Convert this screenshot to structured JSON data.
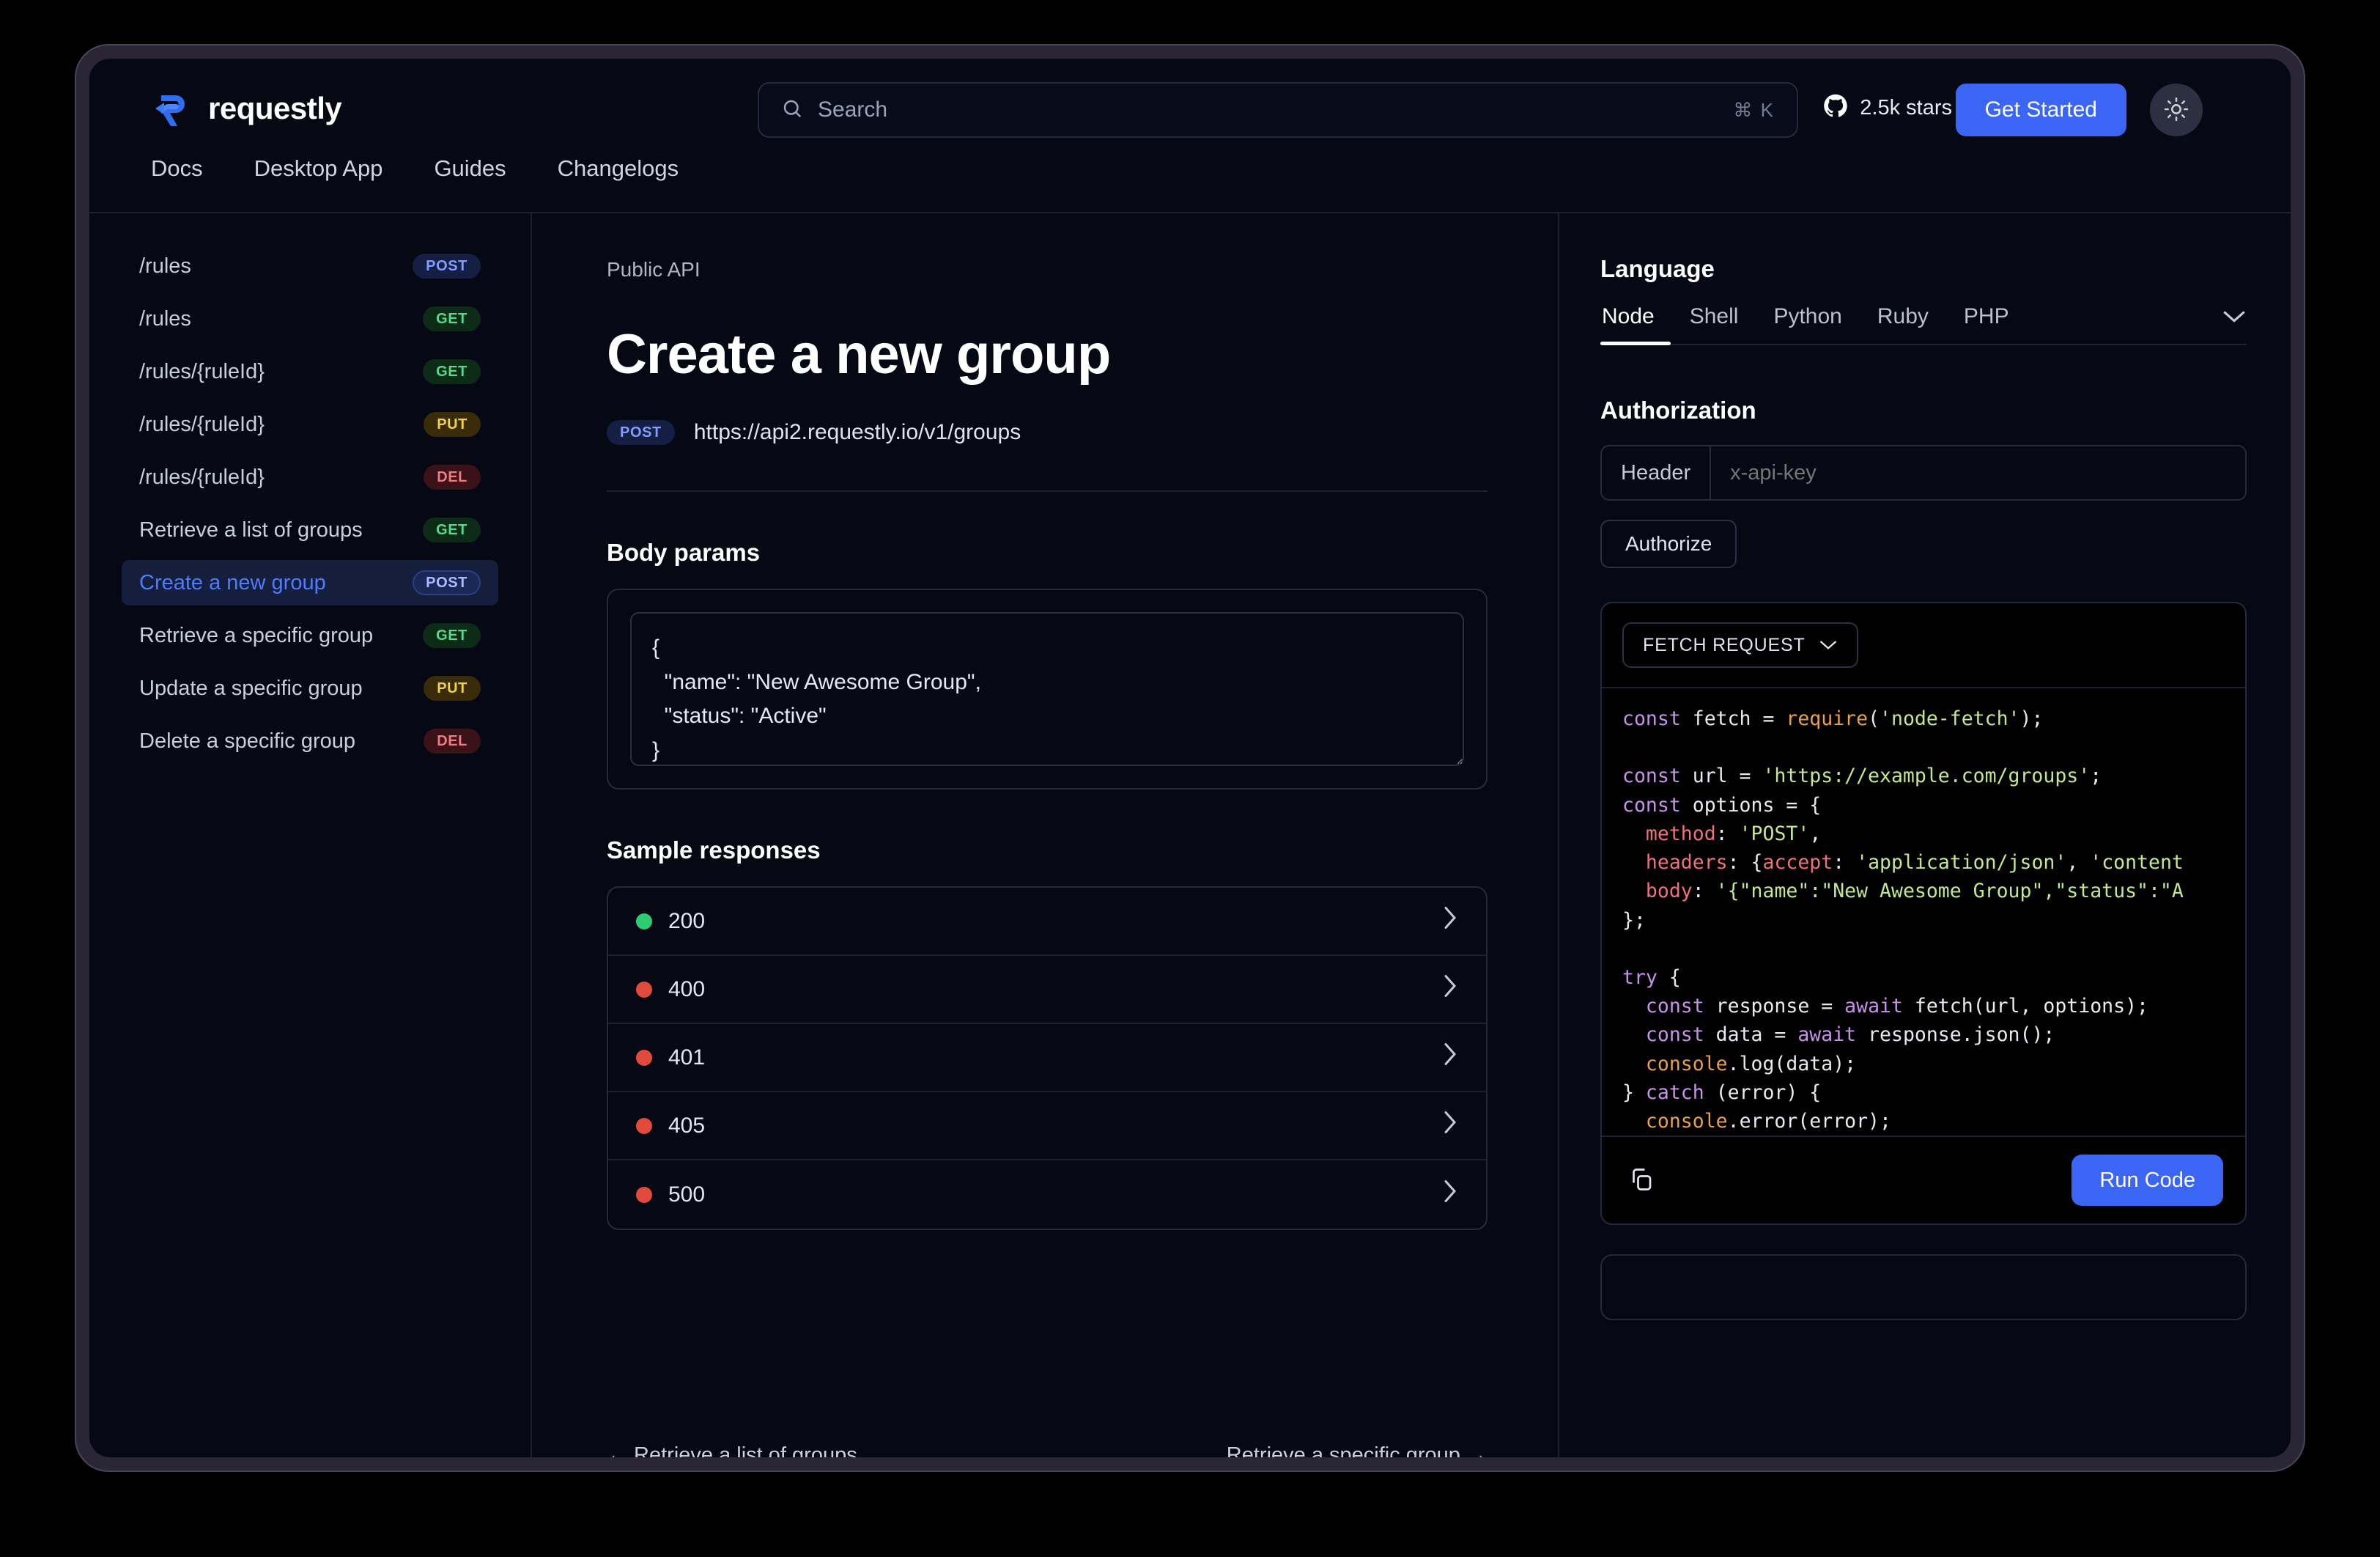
{
  "brand": {
    "name": "requestly",
    "logo_icon": "requestly-r-logo"
  },
  "search": {
    "placeholder": "Search",
    "shortcut": "⌘ K",
    "icon": "search-icon"
  },
  "header": {
    "github_icon": "github-icon",
    "stars_label": "2.5k stars",
    "get_started_label": "Get Started",
    "theme_icon": "sun-icon"
  },
  "nav": {
    "tabs": [
      "Docs",
      "Desktop App",
      "Guides",
      "Changelogs"
    ]
  },
  "sidebar": {
    "items": [
      {
        "label": "/rules",
        "method": "POST",
        "active": false
      },
      {
        "label": "/rules",
        "method": "GET",
        "active": false
      },
      {
        "label": "/rules/{ruleId}",
        "method": "GET",
        "active": false
      },
      {
        "label": "/rules/{ruleId}",
        "method": "PUT",
        "active": false
      },
      {
        "label": "/rules/{ruleId}",
        "method": "DEL",
        "active": false
      },
      {
        "label": "Retrieve a list of groups",
        "method": "GET",
        "active": false
      },
      {
        "label": "Create a new group",
        "method": "POST",
        "active": true
      },
      {
        "label": "Retrieve a specific group",
        "method": "GET",
        "active": false
      },
      {
        "label": "Update a specific group",
        "method": "PUT",
        "active": false
      },
      {
        "label": "Delete a specific group",
        "method": "DEL",
        "active": false
      }
    ]
  },
  "main": {
    "breadcrumb": "Public API",
    "title": "Create a new group",
    "endpoint_method": "POST",
    "endpoint_url": "https://api2.requestly.io/v1/groups",
    "body_params_heading": "Body params",
    "body_params_value": "{\n  \"name\": \"New Awesome Group\",\n  \"status\": \"Active\"\n}",
    "sample_responses_heading": "Sample responses",
    "responses": [
      {
        "code": "200",
        "color": "#2ecc71"
      },
      {
        "code": "400",
        "color": "#e24b3c"
      },
      {
        "code": "401",
        "color": "#e24b3c"
      },
      {
        "code": "405",
        "color": "#e24b3c"
      },
      {
        "code": "500",
        "color": "#e24b3c"
      }
    ],
    "pager_prev": "←  Retrieve a list of groups",
    "pager_next": "Retrieve a specific group  →"
  },
  "right": {
    "language_heading": "Language",
    "language_tabs": [
      "Node",
      "Shell",
      "Python",
      "Ruby",
      "PHP"
    ],
    "language_active": "Node",
    "more_icon": "chevron-down-icon",
    "authorization_heading": "Authorization",
    "auth_type_label": "Header",
    "auth_key_placeholder": "x-api-key",
    "authorize_label": "Authorize",
    "snippet_select_label": "FETCH REQUEST",
    "copy_icon": "copy-icon",
    "run_code_label": "Run Code",
    "code_lines": [
      [
        [
          "t-kw",
          "const"
        ],
        [
          "t-pl",
          " fetch = "
        ],
        [
          "t-fn",
          "require"
        ],
        [
          "t-pl",
          "("
        ],
        [
          "t-str",
          "'node-fetch'"
        ],
        [
          "t-pl",
          ");"
        ]
      ],
      [
        [
          "t-pl",
          ""
        ]
      ],
      [
        [
          "t-kw",
          "const"
        ],
        [
          "t-pl",
          " url = "
        ],
        [
          "t-str",
          "'https://example.com/groups'"
        ],
        [
          "t-pl",
          ";"
        ]
      ],
      [
        [
          "t-kw",
          "const"
        ],
        [
          "t-pl",
          " options = {"
        ]
      ],
      [
        [
          "t-pl",
          "  "
        ],
        [
          "t-prop",
          "method"
        ],
        [
          "t-pl",
          ": "
        ],
        [
          "t-str",
          "'POST'"
        ],
        [
          "t-pl",
          ","
        ]
      ],
      [
        [
          "t-pl",
          "  "
        ],
        [
          "t-prop",
          "headers"
        ],
        [
          "t-pl",
          ": {"
        ],
        [
          "t-prop",
          "accept"
        ],
        [
          "t-pl",
          ": "
        ],
        [
          "t-str",
          "'application/json'"
        ],
        [
          "t-pl",
          ", "
        ],
        [
          "t-str",
          "'content"
        ]
      ],
      [
        [
          "t-pl",
          "  "
        ],
        [
          "t-prop",
          "body"
        ],
        [
          "t-pl",
          ": "
        ],
        [
          "t-str",
          "'{\"name\":\"New Awesome Group\",\"status\":\"A"
        ]
      ],
      [
        [
          "t-pl",
          "};"
        ]
      ],
      [
        [
          "t-pl",
          ""
        ]
      ],
      [
        [
          "t-kw",
          "try"
        ],
        [
          "t-pl",
          " {"
        ]
      ],
      [
        [
          "t-pl",
          "  "
        ],
        [
          "t-kw",
          "const"
        ],
        [
          "t-pl",
          " response = "
        ],
        [
          "t-kw",
          "await"
        ],
        [
          "t-pl",
          " fetch(url, options);"
        ]
      ],
      [
        [
          "t-pl",
          "  "
        ],
        [
          "t-kw",
          "const"
        ],
        [
          "t-pl",
          " data = "
        ],
        [
          "t-kw",
          "await"
        ],
        [
          "t-pl",
          " response.json();"
        ]
      ],
      [
        [
          "t-pl",
          "  "
        ],
        [
          "t-fn",
          "console"
        ],
        [
          "t-pl",
          ".log(data);"
        ]
      ],
      [
        [
          "t-pl",
          "} "
        ],
        [
          "t-kw",
          "catch"
        ],
        [
          "t-pl",
          " (error) {"
        ]
      ],
      [
        [
          "t-pl",
          "  "
        ],
        [
          "t-fn",
          "console"
        ],
        [
          "t-pl",
          ".error(error);"
        ]
      ],
      [
        [
          "t-pl",
          "}"
        ]
      ]
    ]
  },
  "colors": {
    "accent": "#3b66f5",
    "page_bg": "#060914",
    "frame": "#2b2636",
    "border": "#1b2132",
    "active_item_bg": "#151e3d",
    "active_item_text": "#4f7cfa"
  }
}
